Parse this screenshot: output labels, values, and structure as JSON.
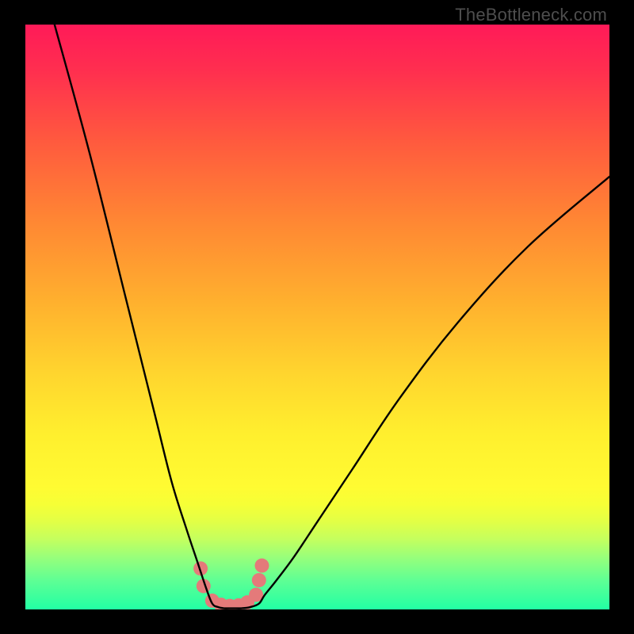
{
  "watermark": "TheBottleneck.com",
  "colors": {
    "background": "#000000",
    "gradient_top": "#ff1a58",
    "gradient_bottom": "#22ffa4",
    "curve": "#000000",
    "dots": "#e47a7a"
  },
  "chart_data": {
    "type": "line",
    "title": "",
    "xlabel": "",
    "ylabel": "",
    "x_range": [
      0,
      100
    ],
    "y_range": [
      0,
      100
    ],
    "series": [
      {
        "name": "left-branch",
        "x": [
          5.0,
          11.0,
          17.0,
          22.0,
          25.0,
          27.5,
          29.5,
          31.0,
          32.0
        ],
        "y": [
          100.0,
          78.0,
          54.0,
          34.0,
          22.0,
          14.0,
          8.0,
          3.5,
          1.0
        ]
      },
      {
        "name": "valley-floor",
        "x": [
          32.0,
          33.0,
          34.0,
          35.5,
          37.0,
          38.5,
          40.0,
          41.0
        ],
        "y": [
          1.0,
          0.4,
          0.2,
          0.2,
          0.2,
          0.4,
          1.0,
          2.5
        ]
      },
      {
        "name": "right-branch",
        "x": [
          41.0,
          43.0,
          46.0,
          50.0,
          56.0,
          64.0,
          74.0,
          86.0,
          100.0
        ],
        "y": [
          2.5,
          5.0,
          9.0,
          15.0,
          24.0,
          36.0,
          49.0,
          62.0,
          74.0
        ]
      }
    ],
    "dots": {
      "name": "valley-points",
      "x": [
        30.0,
        30.5,
        32.0,
        33.5,
        35.0,
        36.5,
        38.0,
        39.5,
        40.0,
        40.5
      ],
      "y": [
        7.0,
        4.0,
        1.5,
        0.8,
        0.6,
        0.7,
        1.2,
        2.5,
        5.0,
        7.5
      ],
      "r": 9
    }
  }
}
